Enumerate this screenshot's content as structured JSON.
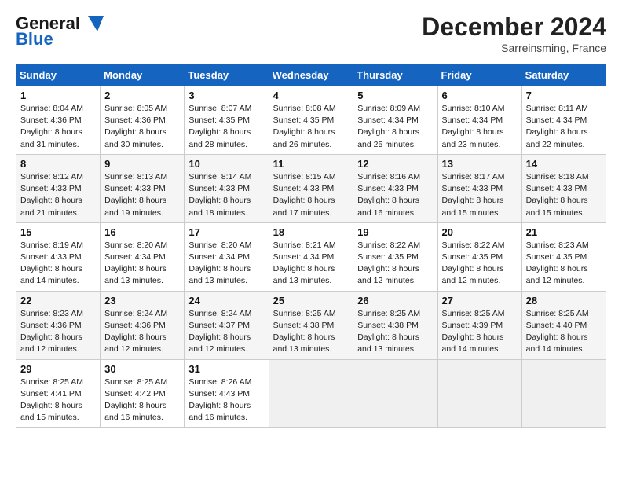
{
  "header": {
    "logo_line1": "General",
    "logo_line2": "Blue",
    "month_title": "December 2024",
    "location": "Sarreinsming, France"
  },
  "weekdays": [
    "Sunday",
    "Monday",
    "Tuesday",
    "Wednesday",
    "Thursday",
    "Friday",
    "Saturday"
  ],
  "weeks": [
    [
      {
        "day": "1",
        "sunrise": "Sunrise: 8:04 AM",
        "sunset": "Sunset: 4:36 PM",
        "daylight": "Daylight: 8 hours and 31 minutes."
      },
      {
        "day": "2",
        "sunrise": "Sunrise: 8:05 AM",
        "sunset": "Sunset: 4:36 PM",
        "daylight": "Daylight: 8 hours and 30 minutes."
      },
      {
        "day": "3",
        "sunrise": "Sunrise: 8:07 AM",
        "sunset": "Sunset: 4:35 PM",
        "daylight": "Daylight: 8 hours and 28 minutes."
      },
      {
        "day": "4",
        "sunrise": "Sunrise: 8:08 AM",
        "sunset": "Sunset: 4:35 PM",
        "daylight": "Daylight: 8 hours and 26 minutes."
      },
      {
        "day": "5",
        "sunrise": "Sunrise: 8:09 AM",
        "sunset": "Sunset: 4:34 PM",
        "daylight": "Daylight: 8 hours and 25 minutes."
      },
      {
        "day": "6",
        "sunrise": "Sunrise: 8:10 AM",
        "sunset": "Sunset: 4:34 PM",
        "daylight": "Daylight: 8 hours and 23 minutes."
      },
      {
        "day": "7",
        "sunrise": "Sunrise: 8:11 AM",
        "sunset": "Sunset: 4:34 PM",
        "daylight": "Daylight: 8 hours and 22 minutes."
      }
    ],
    [
      {
        "day": "8",
        "sunrise": "Sunrise: 8:12 AM",
        "sunset": "Sunset: 4:33 PM",
        "daylight": "Daylight: 8 hours and 21 minutes."
      },
      {
        "day": "9",
        "sunrise": "Sunrise: 8:13 AM",
        "sunset": "Sunset: 4:33 PM",
        "daylight": "Daylight: 8 hours and 19 minutes."
      },
      {
        "day": "10",
        "sunrise": "Sunrise: 8:14 AM",
        "sunset": "Sunset: 4:33 PM",
        "daylight": "Daylight: 8 hours and 18 minutes."
      },
      {
        "day": "11",
        "sunrise": "Sunrise: 8:15 AM",
        "sunset": "Sunset: 4:33 PM",
        "daylight": "Daylight: 8 hours and 17 minutes."
      },
      {
        "day": "12",
        "sunrise": "Sunrise: 8:16 AM",
        "sunset": "Sunset: 4:33 PM",
        "daylight": "Daylight: 8 hours and 16 minutes."
      },
      {
        "day": "13",
        "sunrise": "Sunrise: 8:17 AM",
        "sunset": "Sunset: 4:33 PM",
        "daylight": "Daylight: 8 hours and 15 minutes."
      },
      {
        "day": "14",
        "sunrise": "Sunrise: 8:18 AM",
        "sunset": "Sunset: 4:33 PM",
        "daylight": "Daylight: 8 hours and 15 minutes."
      }
    ],
    [
      {
        "day": "15",
        "sunrise": "Sunrise: 8:19 AM",
        "sunset": "Sunset: 4:33 PM",
        "daylight": "Daylight: 8 hours and 14 minutes."
      },
      {
        "day": "16",
        "sunrise": "Sunrise: 8:20 AM",
        "sunset": "Sunset: 4:34 PM",
        "daylight": "Daylight: 8 hours and 13 minutes."
      },
      {
        "day": "17",
        "sunrise": "Sunrise: 8:20 AM",
        "sunset": "Sunset: 4:34 PM",
        "daylight": "Daylight: 8 hours and 13 minutes."
      },
      {
        "day": "18",
        "sunrise": "Sunrise: 8:21 AM",
        "sunset": "Sunset: 4:34 PM",
        "daylight": "Daylight: 8 hours and 13 minutes."
      },
      {
        "day": "19",
        "sunrise": "Sunrise: 8:22 AM",
        "sunset": "Sunset: 4:35 PM",
        "daylight": "Daylight: 8 hours and 12 minutes."
      },
      {
        "day": "20",
        "sunrise": "Sunrise: 8:22 AM",
        "sunset": "Sunset: 4:35 PM",
        "daylight": "Daylight: 8 hours and 12 minutes."
      },
      {
        "day": "21",
        "sunrise": "Sunrise: 8:23 AM",
        "sunset": "Sunset: 4:35 PM",
        "daylight": "Daylight: 8 hours and 12 minutes."
      }
    ],
    [
      {
        "day": "22",
        "sunrise": "Sunrise: 8:23 AM",
        "sunset": "Sunset: 4:36 PM",
        "daylight": "Daylight: 8 hours and 12 minutes."
      },
      {
        "day": "23",
        "sunrise": "Sunrise: 8:24 AM",
        "sunset": "Sunset: 4:36 PM",
        "daylight": "Daylight: 8 hours and 12 minutes."
      },
      {
        "day": "24",
        "sunrise": "Sunrise: 8:24 AM",
        "sunset": "Sunset: 4:37 PM",
        "daylight": "Daylight: 8 hours and 12 minutes."
      },
      {
        "day": "25",
        "sunrise": "Sunrise: 8:25 AM",
        "sunset": "Sunset: 4:38 PM",
        "daylight": "Daylight: 8 hours and 13 minutes."
      },
      {
        "day": "26",
        "sunrise": "Sunrise: 8:25 AM",
        "sunset": "Sunset: 4:38 PM",
        "daylight": "Daylight: 8 hours and 13 minutes."
      },
      {
        "day": "27",
        "sunrise": "Sunrise: 8:25 AM",
        "sunset": "Sunset: 4:39 PM",
        "daylight": "Daylight: 8 hours and 14 minutes."
      },
      {
        "day": "28",
        "sunrise": "Sunrise: 8:25 AM",
        "sunset": "Sunset: 4:40 PM",
        "daylight": "Daylight: 8 hours and 14 minutes."
      }
    ],
    [
      {
        "day": "29",
        "sunrise": "Sunrise: 8:25 AM",
        "sunset": "Sunset: 4:41 PM",
        "daylight": "Daylight: 8 hours and 15 minutes."
      },
      {
        "day": "30",
        "sunrise": "Sunrise: 8:25 AM",
        "sunset": "Sunset: 4:42 PM",
        "daylight": "Daylight: 8 hours and 16 minutes."
      },
      {
        "day": "31",
        "sunrise": "Sunrise: 8:26 AM",
        "sunset": "Sunset: 4:43 PM",
        "daylight": "Daylight: 8 hours and 16 minutes."
      },
      null,
      null,
      null,
      null
    ]
  ]
}
